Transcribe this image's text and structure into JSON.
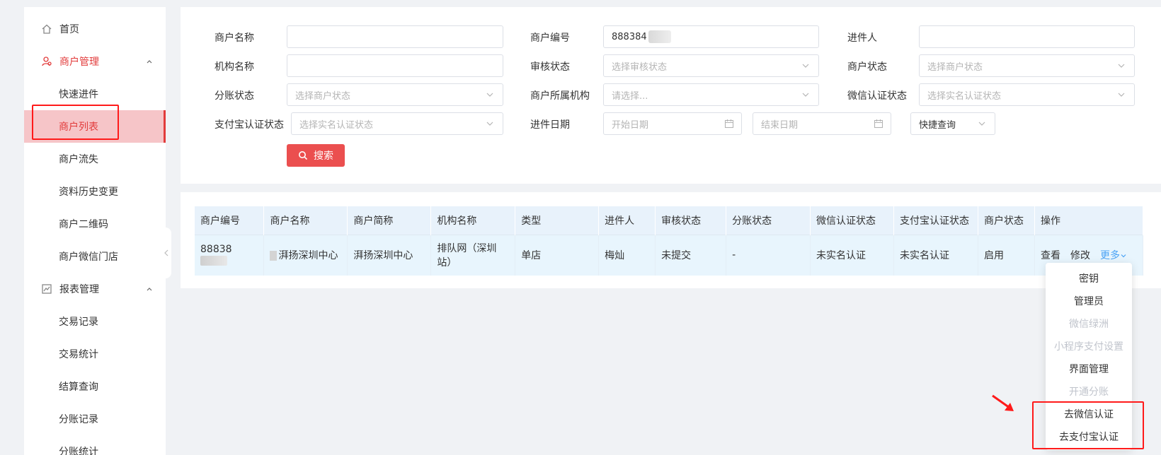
{
  "sidebar": {
    "items": [
      {
        "label": "首页",
        "type": "item"
      },
      {
        "label": "商户管理",
        "type": "group"
      },
      {
        "label": "快速进件",
        "type": "sub"
      },
      {
        "label": "商户列表",
        "type": "sub",
        "active": true
      },
      {
        "label": "商户流失",
        "type": "sub"
      },
      {
        "label": "资料历史变更",
        "type": "sub"
      },
      {
        "label": "商户二维码",
        "type": "sub"
      },
      {
        "label": "商户微信门店",
        "type": "sub"
      },
      {
        "label": "报表管理",
        "type": "group"
      },
      {
        "label": "交易记录",
        "type": "sub"
      },
      {
        "label": "交易统计",
        "type": "sub"
      },
      {
        "label": "结算查询",
        "type": "sub"
      },
      {
        "label": "分账记录",
        "type": "sub"
      },
      {
        "label": "分账统计",
        "type": "sub"
      }
    ]
  },
  "search": {
    "merchant_name": {
      "label": "商户名称",
      "value": ""
    },
    "merchant_no": {
      "label": "商户编号",
      "value": "888384"
    },
    "submitter": {
      "label": "进件人",
      "value": ""
    },
    "org_name": {
      "label": "机构名称",
      "value": ""
    },
    "audit_status": {
      "label": "审核状态",
      "placeholder": "选择审核状态"
    },
    "merchant_status": {
      "label": "商户状态",
      "placeholder": "选择商户状态"
    },
    "split_status": {
      "label": "分账状态",
      "placeholder": "选择商户状态"
    },
    "merchant_org": {
      "label": "商户所属机构",
      "placeholder": "请选择..."
    },
    "wechat_auth": {
      "label": "微信认证状态",
      "placeholder": "选择实名认证状态"
    },
    "alipay_auth": {
      "label": "支付宝认证状态",
      "placeholder": "选择实名认证状态"
    },
    "submit_date": {
      "label": "进件日期",
      "start_placeholder": "开始日期",
      "end_placeholder": "结束日期"
    },
    "quick_query": "快捷查询",
    "search_button": "搜索"
  },
  "table": {
    "headers": [
      "商户编号",
      "商户名称",
      "商户简称",
      "机构名称",
      "类型",
      "进件人",
      "审核状态",
      "分账状态",
      "微信认证状态",
      "支付宝认证状态",
      "商户状态",
      "操作"
    ],
    "row": {
      "merchant_no": "88838",
      "merchant_name": "湃扬深圳中心",
      "short_name": "湃扬深圳中心",
      "org_name": "排队网（深圳站）",
      "type": "单店",
      "submitter": "梅灿",
      "audit_status": "未提交",
      "split_status": "-",
      "wechat_auth": "未实名认证",
      "alipay_auth": "未实名认证",
      "merchant_status": "启用",
      "ops": {
        "view": "查看",
        "edit": "修改",
        "more": "更多"
      }
    }
  },
  "dropdown": {
    "items": [
      {
        "label": "密钥",
        "disabled": false
      },
      {
        "label": "管理员",
        "disabled": false
      },
      {
        "label": "微信绿洲",
        "disabled": true
      },
      {
        "label": "小程序支付设置",
        "disabled": true
      },
      {
        "label": "界面管理",
        "disabled": false
      },
      {
        "label": "开通分账",
        "disabled": true
      },
      {
        "label": "去微信认证",
        "disabled": false
      },
      {
        "label": "去支付宝认证",
        "disabled": false
      }
    ]
  },
  "colors": {
    "accent": "#e23b3b",
    "link": "#4ba3f5",
    "annotation": "#ff1a1a"
  }
}
